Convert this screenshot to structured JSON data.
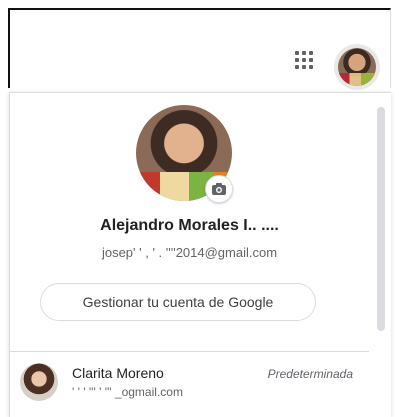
{
  "header": {
    "apps_icon": "apps-grid-icon",
    "avatar_icon": "profile-avatar"
  },
  "account_menu": {
    "name": "Alejandro Morales I.. ....",
    "email": "josep' ' , ' . ''''2014@gmail.com",
    "camera_icon": "camera-icon",
    "manage_label": "Gestionar tu cuenta de Google"
  },
  "other_accounts": [
    {
      "name": "Clarita Moreno",
      "email": "' ' ' ''' ' ''' _ogmail.com",
      "badge": "Predeterminada"
    }
  ],
  "colors": {
    "text_primary": "#202124",
    "text_secondary": "#5f6368",
    "border": "#dadce0"
  }
}
